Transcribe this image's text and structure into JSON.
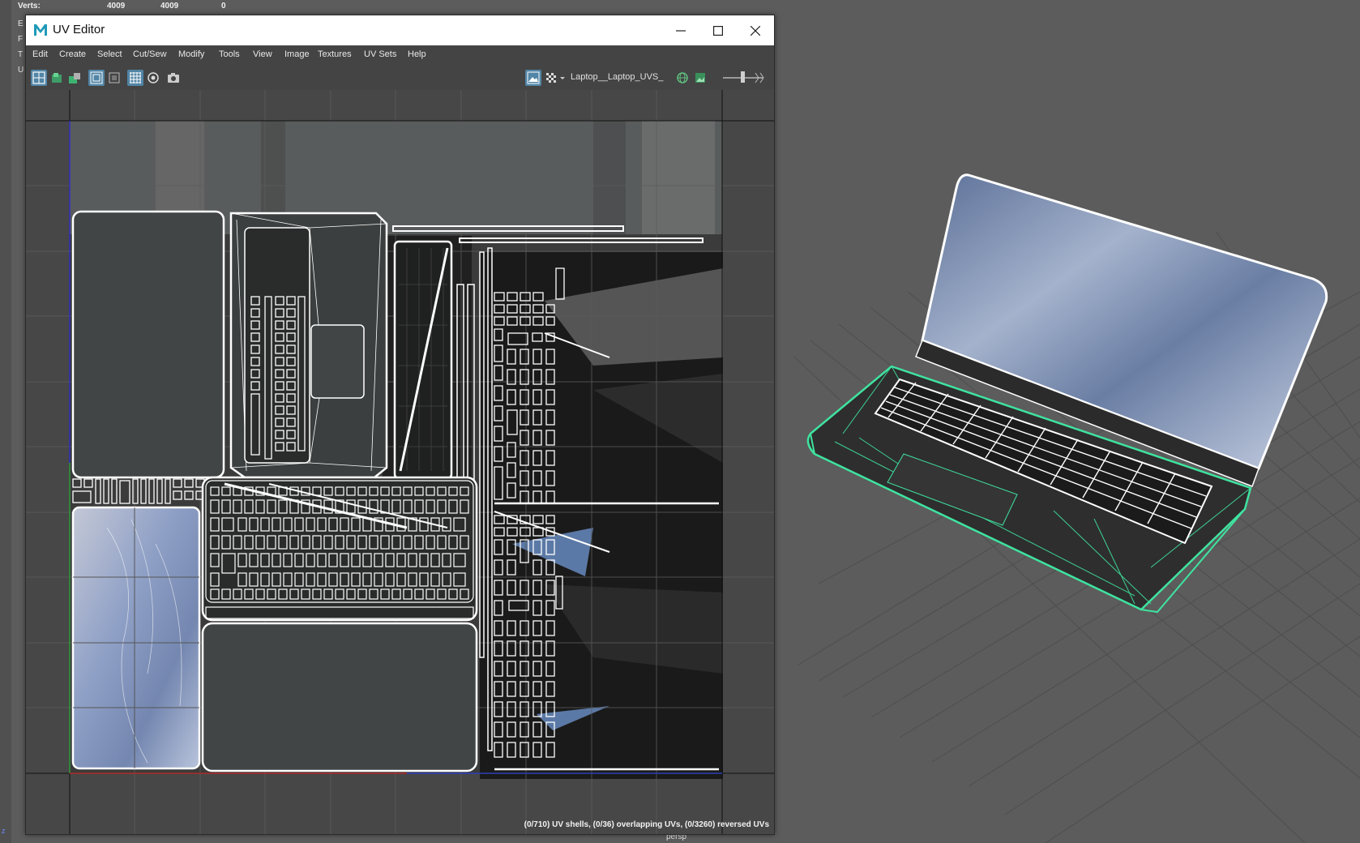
{
  "hud": {
    "rows": [
      {
        "label": "Verts:",
        "v1": "4009",
        "v2": "4009",
        "v3": "0"
      }
    ],
    "side_labels": [
      "E",
      "F",
      "T",
      "U"
    ]
  },
  "viewport": {
    "camera_label": "persp"
  },
  "uv_editor": {
    "title": "UV Editor",
    "menus": [
      "Edit",
      "Create",
      "Select",
      "Cut/Sew",
      "Modify",
      "Tools",
      "View",
      "Image",
      "Textures",
      "UV Sets",
      "Help"
    ],
    "uv_set": "Laptop__Laptop_UVS_",
    "status": "(0/710) UV shells, (0/36) overlapping UVs, (0/3260) reversed UVs"
  },
  "colors": {
    "window_bg": "#444444",
    "accent": "#5285a6",
    "wire_green": "#3fe3a0",
    "viewport_bg": "#5c5c5c"
  },
  "icons": {
    "app": "maya-logo-icon",
    "minimize": "minimize-icon",
    "maximize": "maximize-icon",
    "close": "close-icon"
  }
}
